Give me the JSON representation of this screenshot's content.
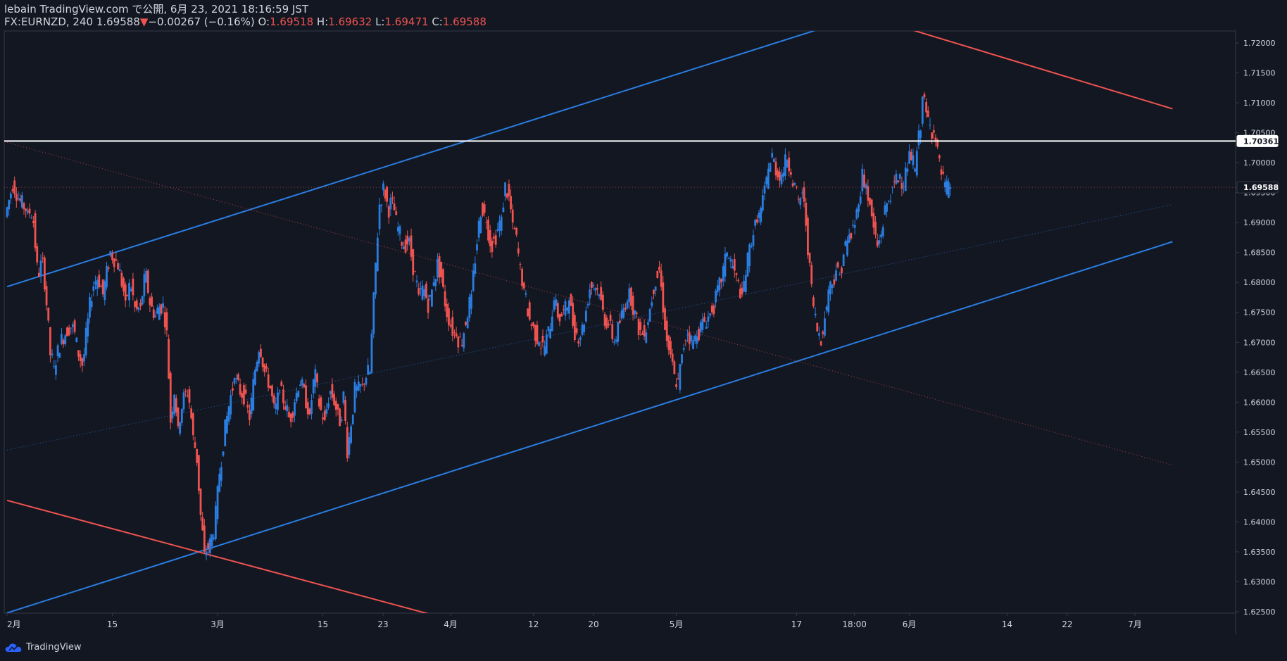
{
  "header": {
    "published": "lebain TradingView.com で公開, 6月 23, 2021 18:16:59 JST",
    "symbol": "FX:EURNZD, 240",
    "last": "1.69588",
    "arrow": "▼",
    "change": "−0.00267 (−0.16%)",
    "o_label": "O:",
    "o_value": "1.69518",
    "h_label": "H:",
    "h_value": "1.69632",
    "l_label": "L:",
    "l_value": "1.69471",
    "c_label": "C:",
    "c_value": "1.69588"
  },
  "footer": {
    "logo_text": "TradingView",
    "logo_icon": "tradingview-cloud-icon"
  },
  "colors": {
    "background": "#131722",
    "up": "#2a7de1",
    "down": "#f05350",
    "text": "#d1d4dc",
    "grid_border": "#363a45",
    "hline": "#ffffff"
  },
  "chart_data": {
    "type": "candlestick",
    "symbol": "FX:EURNZD",
    "interval": "240",
    "ylim": [
      1.6245,
      1.7225
    ],
    "y_ticks": [
      "1.72000",
      "1.71500",
      "1.71000",
      "1.70500",
      "1.70000",
      "1.69500",
      "1.69000",
      "1.68500",
      "1.68000",
      "1.67500",
      "1.67000",
      "1.66500",
      "1.66000",
      "1.65500",
      "1.65000",
      "1.64500",
      "1.64000",
      "1.63500",
      "1.63000",
      "1.62500"
    ],
    "x_ticks": [
      {
        "label": "2月",
        "t": 0.0
      },
      {
        "label": "15",
        "t": 14.0
      },
      {
        "label": "3月",
        "t": 28.0
      },
      {
        "label": "15",
        "t": 42.0
      },
      {
        "label": "23",
        "t": 50.0
      },
      {
        "label": "4月",
        "t": 59.0
      },
      {
        "label": "12",
        "t": 70.0
      },
      {
        "label": "20",
        "t": 78.0
      },
      {
        "label": "5月",
        "t": 89.0
      },
      {
        "label": "17",
        "t": 105.0
      },
      {
        "label": "18:00",
        "t": 112.7
      },
      {
        "label": "6月",
        "t": 120.0
      },
      {
        "label": "14",
        "t": 133.0
      },
      {
        "label": "22",
        "t": 141.0
      },
      {
        "label": "7月",
        "t": 150.0
      }
    ],
    "price_labels": [
      {
        "value": "1.70361",
        "style": "white"
      },
      {
        "value": "1.69588",
        "style": "last"
      }
    ],
    "hline": 1.70361,
    "last_price": 1.69588,
    "trendlines": [
      {
        "name": "upper-blue-channel",
        "color": "#2a7de1",
        "t1": 0,
        "y1": 1.6793,
        "t2": 108.5,
        "y2": 1.7225
      },
      {
        "name": "lower-blue-channel",
        "color": "#2a7de1",
        "t1": 0,
        "y1": 1.6248,
        "t2": 155,
        "y2": 1.6868
      },
      {
        "name": "upper-red-line",
        "color": "#f05350",
        "t1": 119.5,
        "y1": 1.7225,
        "t2": 155,
        "y2": 1.709
      },
      {
        "name": "lower-red-line",
        "color": "#f05350",
        "t1": 0,
        "y1": 1.6436,
        "t2": 56.5,
        "y2": 1.6245
      },
      {
        "name": "dotted-red-line",
        "color": "#f05350",
        "t1": 0,
        "y1": 1.7034,
        "t2": 155,
        "y2": 1.6495,
        "dotted": true
      },
      {
        "name": "dotted-blue-midline",
        "color": "#2a7de1",
        "t1": 0,
        "y1": 1.652,
        "t2": 155,
        "y2": 1.693,
        "dotted": true
      }
    ],
    "candles_4h": [
      [
        0.0,
        1.691,
        1.6965,
        1.6935,
        1.692
      ],
      [
        3.0,
        1.692,
        1.6915,
        1.681,
        1.684
      ],
      [
        5.0,
        1.684,
        1.6765,
        1.668,
        1.666
      ],
      [
        6.5,
        1.666,
        1.67,
        1.672,
        1.673
      ],
      [
        9.0,
        1.673,
        1.6685,
        1.666,
        1.674
      ],
      [
        11.0,
        1.674,
        1.6795,
        1.681,
        1.678
      ],
      [
        13.0,
        1.678,
        1.685,
        1.683,
        1.677
      ],
      [
        16.0,
        1.677,
        1.68,
        1.675,
        1.676
      ],
      [
        18.0,
        1.676,
        1.6815,
        1.676,
        1.6745
      ],
      [
        20.0,
        1.6745,
        1.676,
        1.676,
        1.672
      ],
      [
        21.5,
        1.672,
        1.657,
        1.662,
        1.656
      ],
      [
        23.0,
        1.656,
        1.6605,
        1.662,
        1.6545
      ],
      [
        25.0,
        1.6545,
        1.6505,
        1.641,
        1.635
      ],
      [
        26.5,
        1.635,
        1.636,
        1.639,
        1.648
      ],
      [
        28.5,
        1.648,
        1.655,
        1.66,
        1.664
      ],
      [
        30.5,
        1.664,
        1.662,
        1.661,
        1.657
      ],
      [
        32.5,
        1.657,
        1.665,
        1.67,
        1.665
      ],
      [
        34.5,
        1.665,
        1.663,
        1.658,
        1.662
      ],
      [
        36.5,
        1.662,
        1.66,
        1.657,
        1.66
      ],
      [
        38.5,
        1.66,
        1.664,
        1.661,
        1.658
      ],
      [
        40.5,
        1.658,
        1.665,
        1.659,
        1.657
      ],
      [
        42.5,
        1.657,
        1.662,
        1.66,
        1.656
      ],
      [
        44.5,
        1.656,
        1.661,
        1.652,
        1.656
      ],
      [
        46.0,
        1.656,
        1.662,
        1.662,
        1.663
      ],
      [
        47.5,
        1.663,
        1.664,
        1.665,
        1.665
      ],
      [
        48.5,
        1.665,
        1.675,
        1.685,
        1.693
      ],
      [
        49.8,
        1.693,
        1.696,
        1.692,
        1.694
      ],
      [
        51.5,
        1.694,
        1.69,
        1.688,
        1.686
      ],
      [
        53.0,
        1.686,
        1.687,
        1.682,
        1.678
      ],
      [
        55.0,
        1.678,
        1.679,
        1.676,
        1.68
      ],
      [
        57.0,
        1.68,
        1.683,
        1.681,
        1.676
      ],
      [
        58.5,
        1.676,
        1.674,
        1.672,
        1.671
      ],
      [
        60.0,
        1.671,
        1.67,
        1.674,
        1.678
      ],
      [
        62.0,
        1.678,
        1.686,
        1.693,
        1.69
      ],
      [
        64.0,
        1.69,
        1.686,
        1.688,
        1.691
      ],
      [
        66.0,
        1.691,
        1.696,
        1.694,
        1.69
      ],
      [
        67.5,
        1.69,
        1.687,
        1.682,
        1.679
      ],
      [
        69.0,
        1.679,
        1.674,
        1.672,
        1.67
      ],
      [
        71.0,
        1.67,
        1.669,
        1.672,
        1.677
      ],
      [
        73.0,
        1.677,
        1.674,
        1.675,
        1.677
      ],
      [
        75.0,
        1.677,
        1.672,
        1.671,
        1.673
      ],
      [
        77.0,
        1.673,
        1.679,
        1.68,
        1.678
      ],
      [
        79.0,
        1.678,
        1.674,
        1.673,
        1.67
      ],
      [
        81.0,
        1.67,
        1.673,
        1.676,
        1.679
      ],
      [
        83.0,
        1.679,
        1.675,
        1.672,
        1.671
      ],
      [
        85.0,
        1.671,
        1.675,
        1.68,
        1.682
      ],
      [
        87.0,
        1.682,
        1.676,
        1.67,
        1.668
      ],
      [
        88.5,
        1.668,
        1.664,
        1.663,
        1.668
      ],
      [
        90.0,
        1.668,
        1.672,
        1.67,
        1.671
      ],
      [
        92.0,
        1.671,
        1.673,
        1.674,
        1.675
      ],
      [
        94.0,
        1.675,
        1.678,
        1.681,
        1.685
      ],
      [
        96.0,
        1.685,
        1.683,
        1.68,
        1.678
      ],
      [
        98.0,
        1.678,
        1.683,
        1.688,
        1.69
      ],
      [
        100.0,
        1.69,
        1.692,
        1.695,
        1.699
      ],
      [
        101.5,
        1.699,
        1.701,
        1.699,
        1.697
      ],
      [
        103.0,
        1.697,
        1.699,
        1.701,
        1.698
      ],
      [
        104.5,
        1.698,
        1.696,
        1.693,
        1.695
      ],
      [
        106.0,
        1.695,
        1.69,
        1.682,
        1.676
      ],
      [
        107.5,
        1.676,
        1.672,
        1.671,
        1.674
      ],
      [
        109.0,
        1.674,
        1.679,
        1.68,
        1.682
      ],
      [
        110.5,
        1.682,
        1.681,
        1.685,
        1.687
      ],
      [
        112.0,
        1.687,
        1.688,
        1.69,
        1.693
      ],
      [
        113.5,
        1.693,
        1.698,
        1.696,
        1.693
      ],
      [
        115.0,
        1.693,
        1.689,
        1.686,
        1.688
      ],
      [
        116.5,
        1.688,
        1.692,
        1.694,
        1.696
      ],
      [
        118.0,
        1.696,
        1.697,
        1.698,
        1.696
      ],
      [
        119.5,
        1.696,
        1.7,
        1.701,
        1.699
      ],
      [
        121.0,
        1.699,
        1.703,
        1.705,
        1.711
      ],
      [
        122.0,
        1.711,
        1.708,
        1.706,
        1.705
      ],
      [
        123.5,
        1.705,
        1.703,
        1.7,
        1.698
      ],
      [
        124.5,
        1.698,
        1.696,
        1.6955,
        1.6959
      ]
    ]
  }
}
